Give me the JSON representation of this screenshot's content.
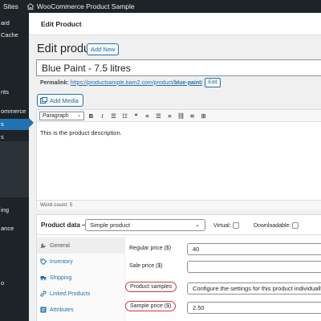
{
  "admin_bar": {
    "sites_label": "Sites",
    "site_name": "WooCommerce Product Sample"
  },
  "side_menu": {
    "items": [
      "ard",
      "Cache",
      "nts",
      "ommerce",
      "s",
      "s",
      "ing",
      "ance",
      "o"
    ]
  },
  "header": {
    "title": "Edit Product"
  },
  "heading": {
    "title": "Edit product",
    "add_new": "Add New"
  },
  "product": {
    "title": "Blue Paint - 7.5 litres",
    "permalink_label": "Permalink:",
    "permalink_base": "https://productsample.barn2.com/product/",
    "permalink_slug": "blue-paint",
    "permalink_trail": "/",
    "edit_label": "Edit"
  },
  "editor": {
    "add_media": "Add Media",
    "format": "Paragraph",
    "toolbar_buttons": [
      {
        "name": "bold-icon",
        "glyph": "B"
      },
      {
        "name": "italic-icon",
        "glyph": "I"
      },
      {
        "name": "bullet-list-icon",
        "glyph": "☰"
      },
      {
        "name": "numbered-list-icon",
        "glyph": "☷"
      },
      {
        "name": "blockquote-icon",
        "glyph": "❝"
      },
      {
        "name": "align-left-icon",
        "glyph": "≡"
      },
      {
        "name": "align-center-icon",
        "glyph": "☰"
      },
      {
        "name": "align-right-icon",
        "glyph": "≡"
      },
      {
        "name": "link-icon",
        "glyph": "⛓"
      },
      {
        "name": "unlink-icon",
        "glyph": "≋"
      },
      {
        "name": "fullscreen-icon",
        "glyph": "⊞"
      }
    ],
    "content": "This is the product description.",
    "word_count": "Word count: 5"
  },
  "product_data": {
    "title": "Product data —",
    "type": "Simple product",
    "virtual_label": "Virtual:",
    "downloadable_label": "Downloadable:",
    "tabs": [
      {
        "label": "General",
        "icon": "wrench-icon"
      },
      {
        "label": "Inventory",
        "icon": "tag-icon"
      },
      {
        "label": "Shipping",
        "icon": "truck-icon"
      },
      {
        "label": "Linked Products",
        "icon": "link-icon"
      },
      {
        "label": "Attributes",
        "icon": "list-icon"
      }
    ],
    "fields": {
      "regular_price_label": "Regular price ($)",
      "regular_price_value": "40",
      "sale_price_label": "Sale price ($)",
      "sale_price_value": "",
      "product_samples_label": "Product samples",
      "product_samples_value": "Configure the settings for this product individually",
      "sample_price_label": "Sample price ($)",
      "sample_price_value": "2.50"
    }
  }
}
